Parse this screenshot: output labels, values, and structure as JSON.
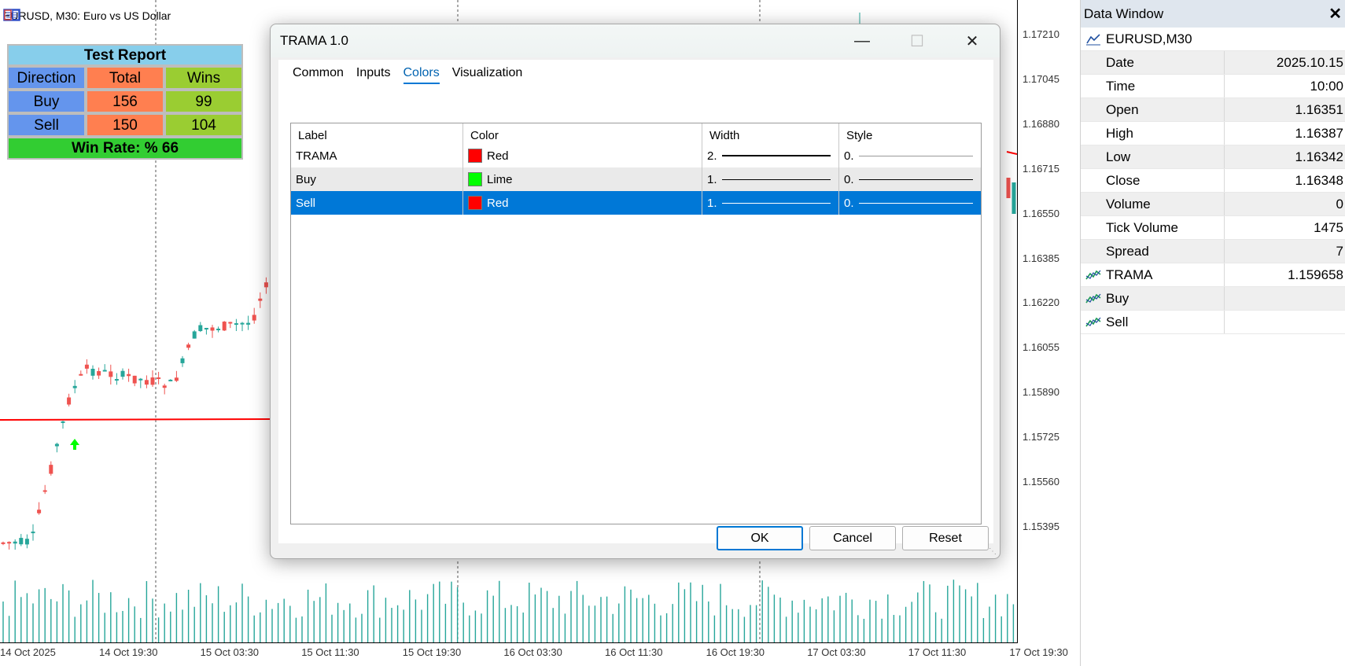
{
  "chart": {
    "title": "EURUSD, M30:  Euro vs US Dollar",
    "price_levels": [
      "1.17210",
      "1.17045",
      "1.16880",
      "1.16715",
      "1.16550",
      "1.16385",
      "1.16220",
      "1.16055",
      "1.15890",
      "1.15725",
      "1.15560",
      "1.15395"
    ],
    "time_labels": [
      "14 Oct 2025",
      "14 Oct 19:30",
      "15 Oct 03:30",
      "15 Oct 11:30",
      "15 Oct 19:30",
      "16 Oct 03:30",
      "16 Oct 11:30",
      "16 Oct 19:30",
      "17 Oct 03:30",
      "17 Oct 11:30",
      "17 Oct 19:30"
    ],
    "colors": {
      "bull": "#26a69a",
      "bear": "#ef5350",
      "trama": "#ff0000",
      "buy_arrow": "#00ff00"
    }
  },
  "report": {
    "title": "Test Report",
    "headers": [
      "Direction",
      "Total",
      "Wins"
    ],
    "rows": [
      {
        "direction": "Buy",
        "total": "156",
        "wins": "99"
      },
      {
        "direction": "Sell",
        "total": "150",
        "wins": "104"
      }
    ],
    "win_rate": "Win Rate: %  66"
  },
  "dialog": {
    "title": "TRAMA 1.0",
    "tabs": [
      "Common",
      "Inputs",
      "Colors",
      "Visualization"
    ],
    "active_tab": "Colors",
    "columns": [
      "Label",
      "Color",
      "Width",
      "Style"
    ],
    "rows": [
      {
        "label": "TRAMA",
        "color_name": "Red",
        "color": "#ff0000",
        "width": "2.",
        "style": "0."
      },
      {
        "label": "Buy",
        "color_name": "Lime",
        "color": "#00ff00",
        "width": "1.",
        "style": "0."
      },
      {
        "label": "Sell",
        "color_name": "Red",
        "color": "#ff0000",
        "width": "1.",
        "style": "0."
      }
    ],
    "buttons": {
      "ok": "OK",
      "cancel": "Cancel",
      "reset": "Reset"
    }
  },
  "data_window": {
    "title": "Data Window",
    "symbol": "EURUSD,M30",
    "rows": [
      {
        "key": "Date",
        "value": "2025.10.15"
      },
      {
        "key": "Time",
        "value": "10:00"
      },
      {
        "key": "Open",
        "value": "1.16351"
      },
      {
        "key": "High",
        "value": "1.16387"
      },
      {
        "key": "Low",
        "value": "1.16342"
      },
      {
        "key": "Close",
        "value": "1.16348"
      },
      {
        "key": "Volume",
        "value": "0"
      },
      {
        "key": "Tick Volume",
        "value": "1475"
      },
      {
        "key": "Spread",
        "value": "7"
      }
    ],
    "indicators": [
      {
        "key": "TRAMA",
        "value": "1.159658"
      },
      {
        "key": "Buy",
        "value": ""
      },
      {
        "key": "Sell",
        "value": ""
      }
    ]
  }
}
